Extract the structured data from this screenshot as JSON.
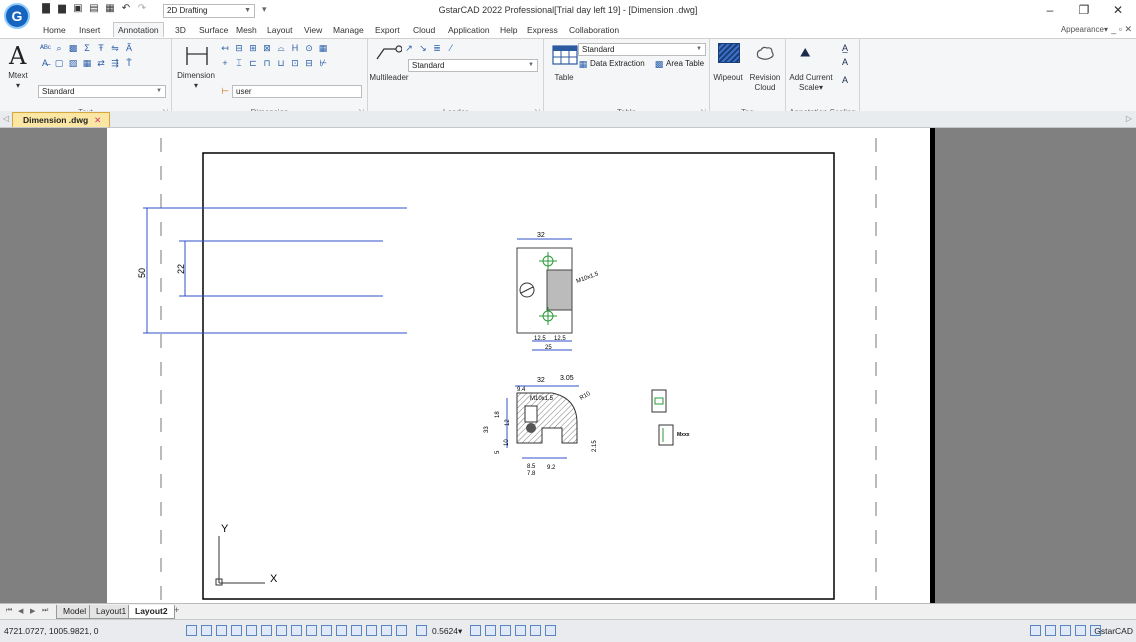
{
  "app": {
    "logo_letter": "G",
    "workspace": "2D Drafting",
    "title": "GstarCAD 2022 Professional[Trial day left 19] - [Dimension .dwg]"
  },
  "ribbon_tabs": [
    "Home",
    "Insert",
    "Annotation",
    "3D",
    "Surface",
    "Mesh",
    "Layout",
    "View",
    "Manage",
    "Export",
    "Cloud",
    "Application",
    "Help",
    "Express",
    "Collaboration"
  ],
  "active_tab": "Annotation",
  "appearance_label": "Appearance",
  "ribbon": {
    "text": {
      "label": "Text",
      "mtext": "Mtext",
      "style": "Standard"
    },
    "dimension": {
      "label": "Dimension",
      "button": "Dimension",
      "style": "user"
    },
    "leader": {
      "label": "Leader",
      "button": "Multileader",
      "style": "Standard"
    },
    "table": {
      "label": "Table",
      "button": "Table",
      "style": "Standard",
      "data_extraction": "Data Extraction",
      "area_table": "Area Table"
    },
    "tag": {
      "label": "Tag",
      "wipeout": "Wipeout",
      "revision": "Revision",
      "cloud": "Cloud"
    },
    "annotation_scaling": {
      "label": "Annotation Scaling",
      "add_current": "Add Current",
      "scale": "Scale"
    }
  },
  "file_tab": {
    "name": "Dimension .dwg"
  },
  "drawing": {
    "dims_left": {
      "outer": "50",
      "inner": "22"
    },
    "top_view": {
      "width": "32",
      "thread": "M10x1.5",
      "d1": "12.5",
      "d2": "12.5",
      "total": "25"
    },
    "section": {
      "w1": "32",
      "w2": "3.05",
      "d_a": "9.4",
      "thread": "M10x1.5",
      "r": "R10",
      "h1": "18",
      "h2": "12",
      "h3": "33",
      "h4": "5",
      "h5": "10",
      "h6": "2.15",
      "b1": "8.5",
      "b2": "7.8",
      "b3": "9.2"
    },
    "detail_note": "Mxxx",
    "ucs_x": "X",
    "ucs_y": "Y"
  },
  "layout_tabs": [
    "Model",
    "Layout1",
    "Layout2"
  ],
  "active_layout": "Layout2",
  "status": {
    "coords": "4721.0727, 1005.9821, 0",
    "zoom": "0.5624",
    "app_name": "GstarCAD"
  }
}
